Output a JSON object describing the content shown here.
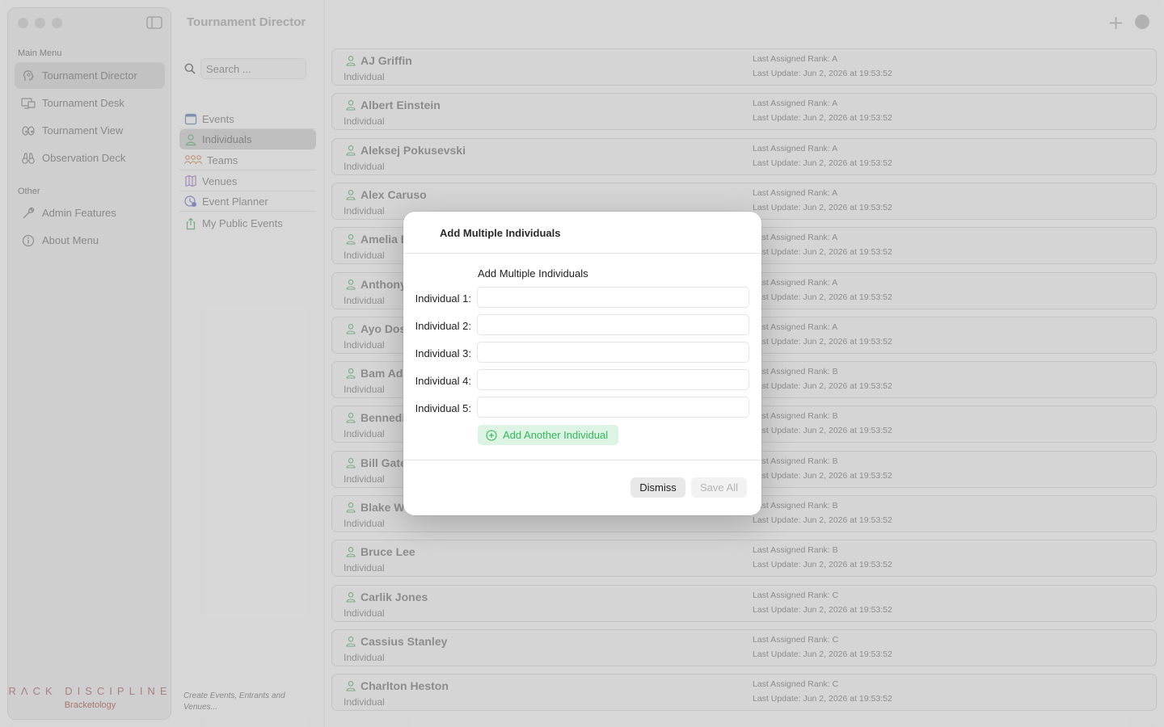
{
  "app": {
    "title": "Tournament Director"
  },
  "sidebar": {
    "main_label": "Main Menu",
    "other_label": "Other",
    "main_items": [
      {
        "label": "Tournament Director",
        "icon": "head-icon",
        "selected": true
      },
      {
        "label": "Tournament Desk",
        "icon": "desk-icon",
        "selected": false
      },
      {
        "label": "Tournament View",
        "icon": "eyes-icon",
        "selected": false
      },
      {
        "label": "Observation Deck",
        "icon": "binoculars-icon",
        "selected": false
      }
    ],
    "other_items": [
      {
        "label": "Admin Features",
        "icon": "wrench-icon"
      },
      {
        "label": "About Menu",
        "icon": "info-icon"
      }
    ],
    "brand": {
      "logo": "RΛCK DISCIPLINE",
      "subtitle": "Bracketology"
    }
  },
  "middle": {
    "search_placeholder": "Search ...",
    "items": [
      {
        "label": "Events",
        "icon": "calendar-icon",
        "selected": false
      },
      {
        "label": "Individuals",
        "icon": "person-icon",
        "selected": true
      },
      {
        "label": "Teams",
        "icon": "team-icon",
        "selected": false
      },
      {
        "label": "Venues",
        "icon": "map-icon",
        "selected": false
      },
      {
        "label": "Event Planner",
        "icon": "planner-icon",
        "selected": false
      },
      {
        "label": "My Public Events",
        "icon": "share-icon",
        "selected": false
      }
    ],
    "footer": "Create Events, Entrants and Venues..."
  },
  "rows": [
    {
      "name": "AJ Griffin",
      "type": "Individual",
      "rank": "Last Assigned Rank: A",
      "update": "Last Update: Jun 2, 2026 at 19:53:52"
    },
    {
      "name": "Albert Einstein",
      "type": "Individual",
      "rank": "Last Assigned Rank: A",
      "update": "Last Update: Jun 2, 2026 at 19:53:52"
    },
    {
      "name": "Aleksej Pokusevski",
      "type": "Individual",
      "rank": "Last Assigned Rank: A",
      "update": "Last Update: Jun 2, 2026 at 19:53:52"
    },
    {
      "name": "Alex Caruso",
      "type": "Individual",
      "rank": "Last Assigned Rank: A",
      "update": "Last Update: Jun 2, 2026 at 19:53:52"
    },
    {
      "name": "Amelia E",
      "type": "Individual",
      "rank": "Last Assigned Rank: A",
      "update": "Last Update: Jun 2, 2026 at 19:53:52"
    },
    {
      "name": "Anthony",
      "type": "Individual",
      "rank": "Last Assigned Rank: A",
      "update": "Last Update: Jun 2, 2026 at 19:53:52"
    },
    {
      "name": "Ayo Dosu",
      "type": "Individual",
      "rank": "Last Assigned Rank: A",
      "update": "Last Update: Jun 2, 2026 at 19:53:52"
    },
    {
      "name": "Bam Ade",
      "type": "Individual",
      "rank": "Last Assigned Rank: B",
      "update": "Last Update: Jun 2, 2026 at 19:53:52"
    },
    {
      "name": "Bennedic",
      "type": "Individual",
      "rank": "Last Assigned Rank: B",
      "update": "Last Update: Jun 2, 2026 at 19:53:52"
    },
    {
      "name": "Bill Gates",
      "type": "Individual",
      "rank": "Last Assigned Rank: B",
      "update": "Last Update: Jun 2, 2026 at 19:53:52"
    },
    {
      "name": "Blake Wes",
      "type": "Individual",
      "rank": "Last Assigned Rank: B",
      "update": "Last Update: Jun 2, 2026 at 19:53:52"
    },
    {
      "name": "Bruce Lee",
      "type": "Individual",
      "rank": "Last Assigned Rank: B",
      "update": "Last Update: Jun 2, 2026 at 19:53:52"
    },
    {
      "name": "Carlik Jones",
      "type": "Individual",
      "rank": "Last Assigned Rank: C",
      "update": "Last Update: Jun 2, 2026 at 19:53:52"
    },
    {
      "name": "Cassius Stanley",
      "type": "Individual",
      "rank": "Last Assigned Rank: C",
      "update": "Last Update: Jun 2, 2026 at 19:53:52"
    },
    {
      "name": "Charlton Heston",
      "type": "Individual",
      "rank": "Last Assigned Rank: C",
      "update": "Last Update: Jun 2, 2026 at 19:53:52"
    }
  ],
  "modal": {
    "title": "Add Multiple Individuals",
    "heading": "Add Multiple Individuals",
    "fields": [
      {
        "label": "Individual 1:",
        "value": ""
      },
      {
        "label": "Individual 2:",
        "value": ""
      },
      {
        "label": "Individual 3:",
        "value": ""
      },
      {
        "label": "Individual 4:",
        "value": ""
      },
      {
        "label": "Individual 5:",
        "value": ""
      }
    ],
    "add_label": "Add Another Individual",
    "dismiss_label": "Dismiss",
    "save_label": "Save All"
  },
  "colors": {
    "accent_green": "#35b75c",
    "brand_red": "#c89494"
  }
}
